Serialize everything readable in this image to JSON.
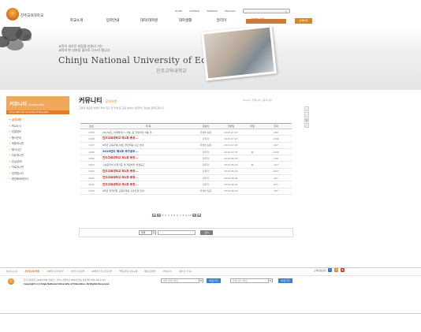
{
  "header": {
    "logo_text": "진주교육대학교",
    "util_links": [
      "HOME",
      "SITEMAP",
      "WEBMAIL",
      "ENGLISH"
    ],
    "gnb": [
      {
        "label": "학교소개",
        "on": false
      },
      {
        "label": "입학안내",
        "on": false
      },
      {
        "label": "대학/대학원",
        "on": false
      },
      {
        "label": "대학생활",
        "on": false
      },
      {
        "label": "알리미",
        "on": false
      },
      {
        "label": "커뮤니티",
        "on": true
      },
      {
        "label": "",
        "on": false
      }
    ],
    "quick_box": "",
    "quick_button": "홈페이지"
  },
  "banner": {
    "slogan_line1": "교육의 새로운 바탕을 만들어 가는",
    "slogan_line2": "교육의 한 부분을 꿈으로 나누어 봅니다",
    "title": "Chinju National University of Education",
    "subtitle": "진주교육대학교"
  },
  "sidebar": {
    "title": "커뮤니티",
    "title_en": "Community",
    "subtitle": "Chinju National University of Education",
    "items": [
      {
        "label": "공지사항",
        "on": true
      },
      {
        "label": "학교소식",
        "on": false
      },
      {
        "label": "입찰정보",
        "on": false
      },
      {
        "label": "행사안내",
        "on": false
      },
      {
        "label": "채용게시판",
        "on": false
      },
      {
        "label": "행사사진",
        "on": false
      },
      {
        "label": "자유게시판",
        "on": false
      },
      {
        "label": "분실/습득",
        "on": false
      },
      {
        "label": "자료게시판",
        "on": false
      },
      {
        "label": "칭찬합시다",
        "on": false
      },
      {
        "label": "총장에게바란다",
        "on": false
      }
    ]
  },
  "main": {
    "title": "커뮤니티",
    "section": "공지사항",
    "breadcrumb": "Home | 커뮤니티 | 공지사항",
    "description": "교육의 새로운 바탕이 되어 학교 전 학생 등 교육 분야의 실질적인 정보를 알려드립니다.",
    "tools": [
      "+",
      "−",
      "▣",
      "⎙"
    ],
    "columns": [
      "번호",
      "제 목",
      "글쓴이",
      "작성일",
      "파일",
      "조회"
    ],
    "rows": [
      {
        "no": "1939",
        "title": "2015년도 하계방학(7~8월) 중 학생식당 식품 안...",
        "style": "",
        "author": "학생처 팀장",
        "date": "2015-07-07",
        "file": "",
        "views": "260"
      },
      {
        "no": "1938",
        "title": "진주교육대학교 제1회 총장...",
        "style": "red",
        "author": "관리자",
        "date": "2015-07-07",
        "file": "",
        "views": "1096"
      },
      {
        "no": "1937",
        "title": "8학년 교육과정(각론) 현장적용 수요 안내",
        "style": "",
        "author": "학생처 팀장",
        "date": "2015-07-01",
        "file": "",
        "views": "447"
      },
      {
        "no": "1936",
        "title": "2015년도 제1회 국가공무...",
        "style": "blue",
        "author": "관리자",
        "date": "2015-07-01",
        "file": "▤",
        "views": "1229"
      },
      {
        "no": "1935",
        "title": "진주교육대학교 제1회 총장...",
        "style": "red",
        "author": "관리자",
        "date": "2015-06-30",
        "file": "",
        "views": "708"
      },
      {
        "no": "1934",
        "title": "시설관리비 산정기준 및 적용방안 변경공고",
        "style": "",
        "author": "관리자",
        "date": "2015-06-29",
        "file": "▤",
        "views": "147"
      },
      {
        "no": "1933",
        "title": "진주교육대학교 제1회 총장...",
        "style": "red",
        "author": "관리자",
        "date": "2015-06-29",
        "file": "",
        "views": "1027"
      },
      {
        "no": "1932",
        "title": "진주교육대학교 제1회 총장...",
        "style": "red",
        "author": "관리자",
        "date": "2015-06-25",
        "file": "",
        "views": "907"
      },
      {
        "no": "1931",
        "title": "진주교육대학교 제1회 총장...",
        "style": "red",
        "author": "관리자",
        "date": "2015-06-25",
        "file": "",
        "views": "831"
      },
      {
        "no": "1930",
        "title": "8학년 입학전형 교원자격증 수강신청 안내",
        "style": "",
        "author": "학생처 팀장",
        "date": "2015-06-23",
        "file": "",
        "views": "397"
      }
    ],
    "pager": {
      "first": "◀◀",
      "prev": "◀",
      "pages": [
        "1",
        "2",
        "3",
        "4",
        "5",
        "6",
        "7",
        "8",
        "9",
        "10"
      ],
      "current": "1",
      "next": "▶",
      "last": "▶▶"
    },
    "search": {
      "select_value": "제목",
      "input_value": "",
      "button": "검색"
    }
  },
  "footer": {
    "menu": [
      "찾아오시는길",
      "개인정보처리방침",
      "이메일무단수집거부",
      "저작권 보호정책",
      "이메일주소무단수집거부",
      "책임공개 및 정보공개",
      "웹접근성정책",
      "관련사이트",
      "웹진 및 소식지"
    ],
    "menu_highlight": "개인정보처리방침",
    "icons_label": "교육정보공개",
    "address_line1": "진주교육대학교 (660-756) 경상남도 진주시 진양호로 369(신안동) 대표전화 055-740-1114",
    "copyright": "Copyright (c) Chinju National University of Education. All Rights Reserved.",
    "family1": "대학 관련사이트",
    "family1_btn": "바로가기",
    "family2": "관계기관 사이트",
    "family2_btn": "바로가기"
  },
  "colors": {
    "accent": "#e07a28",
    "notice_red": "#c41e1e",
    "notice_blue": "#1a3da8"
  }
}
